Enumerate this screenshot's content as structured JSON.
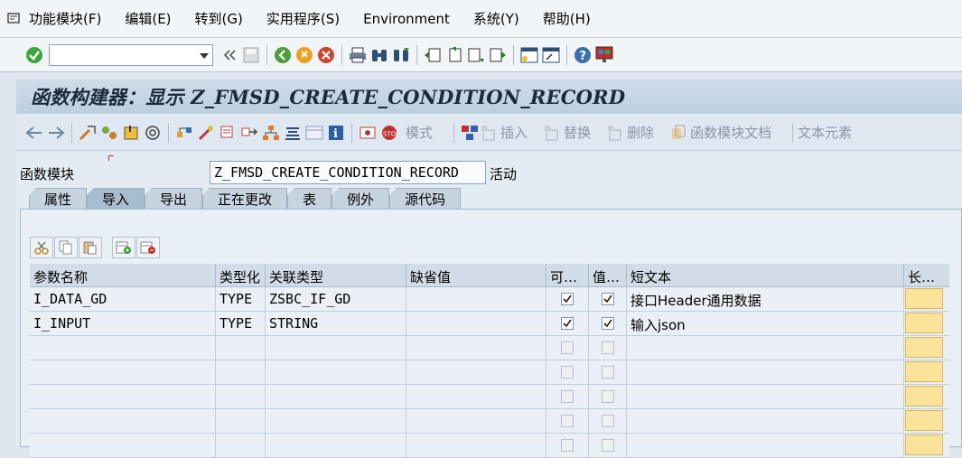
{
  "menu": {
    "items": [
      "功能模块(F)",
      "编辑(E)",
      "转到(G)",
      "实用程序(S)",
      "Environment",
      "系统(Y)",
      "帮助(H)"
    ]
  },
  "toolbar": {
    "command_value": "",
    "icons": [
      "ok-icon",
      "back-arrows-icon",
      "save-icon",
      "back-icon",
      "exit-icon",
      "cancel-icon",
      "print-icon",
      "find-icon",
      "find-next-icon",
      "first-page-icon",
      "prev-page-icon",
      "next-page-icon",
      "last-page-icon",
      "new-session-icon",
      "shortcut-icon",
      "help-icon",
      "layout-icon"
    ]
  },
  "title": "函数构建器：显示 Z_FMSD_CREATE_CONDITION_RECORD",
  "app_toolbar": {
    "mode_label": "模式",
    "insert_label": "插入",
    "replace_label": "替换",
    "delete_label": "删除",
    "fm_doc_label": "函数模块文档",
    "text_elements_label": "文本元素"
  },
  "function_module": {
    "label": "函数模块",
    "name": "Z_FMSD_CREATE_CONDITION_RECORD",
    "status": "活动"
  },
  "tabs": [
    {
      "label": "属性",
      "active": false
    },
    {
      "label": "导入",
      "active": true
    },
    {
      "label": "导出",
      "active": false
    },
    {
      "label": "正在更改",
      "active": false
    },
    {
      "label": "表",
      "active": false
    },
    {
      "label": "例外",
      "active": false
    },
    {
      "label": "源代码",
      "active": false
    }
  ],
  "grid": {
    "headers": [
      "参数名称",
      "类型化",
      "关联类型",
      "缺省值",
      "可…",
      "值…",
      "短文本",
      "长…"
    ],
    "rows": [
      {
        "name": "I_DATA_GD",
        "typing": "TYPE",
        "assoc_type": "ZSBC_IF_GD",
        "default": "",
        "optional": true,
        "pass_value": true,
        "short_text": "接口Header通用数据"
      },
      {
        "name": "I_INPUT",
        "typing": "TYPE",
        "assoc_type": "STRING",
        "default": "",
        "optional": true,
        "pass_value": true,
        "short_text": "输入json"
      },
      {
        "name": "",
        "typing": "",
        "assoc_type": "",
        "default": "",
        "optional": false,
        "pass_value": false,
        "short_text": ""
      },
      {
        "name": "",
        "typing": "",
        "assoc_type": "",
        "default": "",
        "optional": false,
        "pass_value": false,
        "short_text": ""
      },
      {
        "name": "",
        "typing": "",
        "assoc_type": "",
        "default": "",
        "optional": false,
        "pass_value": false,
        "short_text": ""
      },
      {
        "name": "",
        "typing": "",
        "assoc_type": "",
        "default": "",
        "optional": false,
        "pass_value": false,
        "short_text": ""
      },
      {
        "name": "",
        "typing": "",
        "assoc_type": "",
        "default": "",
        "optional": false,
        "pass_value": false,
        "short_text": ""
      }
    ]
  },
  "colors": {
    "title_bg": "#c3d4e4",
    "long_text_button": "#fbe49a",
    "ok_green": "#3aa83a"
  }
}
